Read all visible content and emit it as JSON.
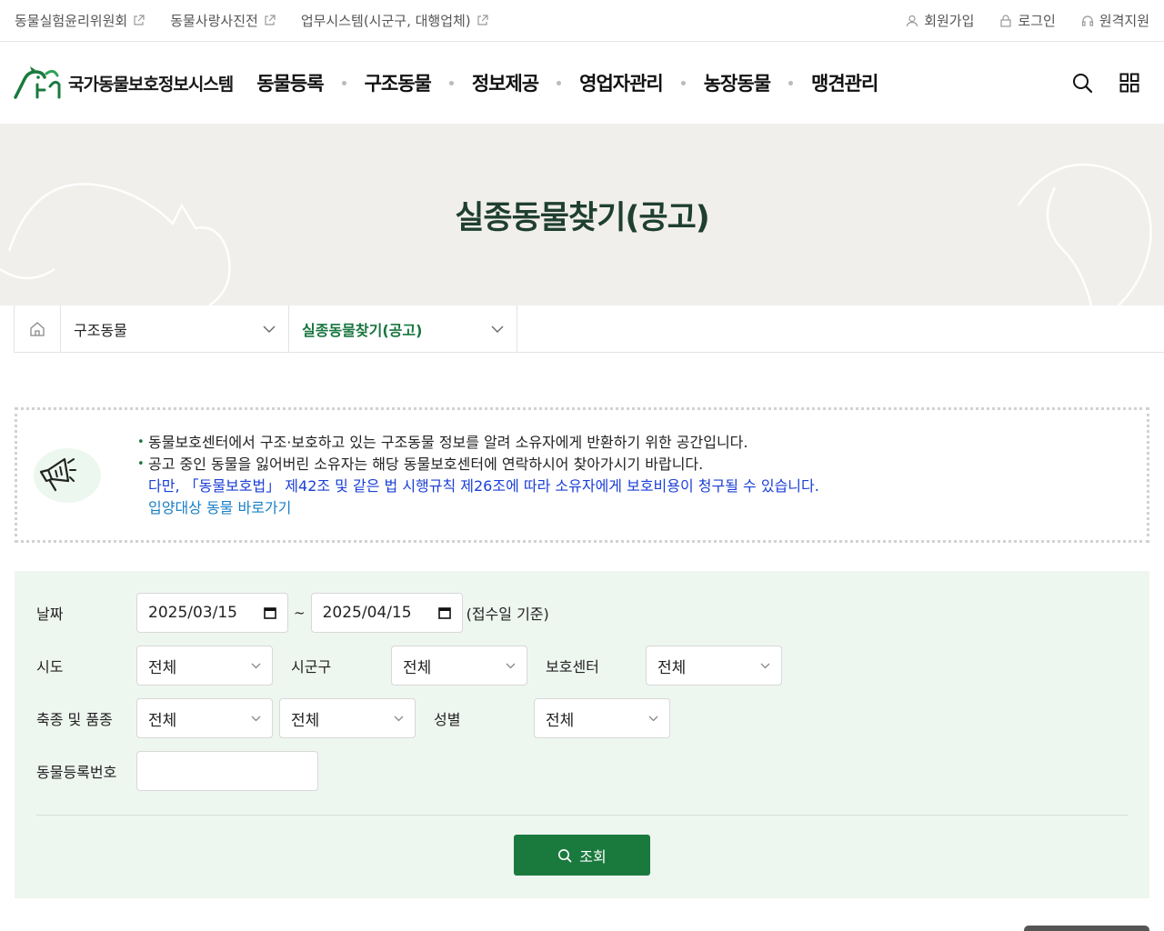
{
  "util": {
    "left": [
      "동물실험윤리위원회",
      "동물사랑사진전",
      "업무시스템(시군구, 대행업체)"
    ],
    "right": [
      "회원가입",
      "로그인",
      "원격지원"
    ]
  },
  "logo": {
    "text": "국가동물보호정보시스템"
  },
  "gnb": [
    "동물등록",
    "구조동물",
    "정보제공",
    "영업자관리",
    "농장동물",
    "맹견관리"
  ],
  "hero": {
    "title": "실종동물찾기(공고)"
  },
  "breadcrumb": {
    "level1": "구조동물",
    "level2": "실종동물찾기(공고)"
  },
  "notice": {
    "line1": "동물보호센터에서 구조·보호하고 있는 구조동물 정보를 알려 소유자에게 반환하기 위한 공간입니다.",
    "line2": "공고 중인 동물을 잃어버린 소유자는 해당 동물보호센터에 연락하시어 찾아가시기 바랍니다.",
    "line3": "다만, 「동물보호법」 제42조 및 같은 법 시행규칙 제26조에 따라 소유자에게 보호비용이 청구될 수 있습니다.",
    "link": "입양대상 동물 바로가기"
  },
  "search": {
    "date_label": "날짜",
    "date_from": "2025/03/15",
    "date_to": "2025/04/15",
    "date_sep": "~",
    "date_hint": "(접수일 기준)",
    "sido_label": "시도",
    "sido_value": "전체",
    "sigungu_label": "시군구",
    "sigungu_value": "전체",
    "center_label": "보호센터",
    "center_value": "전체",
    "species_label": "축종 및 품종",
    "species_value": "전체",
    "breed_value": "전체",
    "sex_label": "성별",
    "sex_value": "전체",
    "regno_label": "동물등록번호",
    "regno_value": "",
    "button": "조회"
  },
  "colors": {
    "brand_green": "#1a7a3e",
    "title_green": "#1f3f30",
    "notice_blue": "#1a3fd6"
  }
}
